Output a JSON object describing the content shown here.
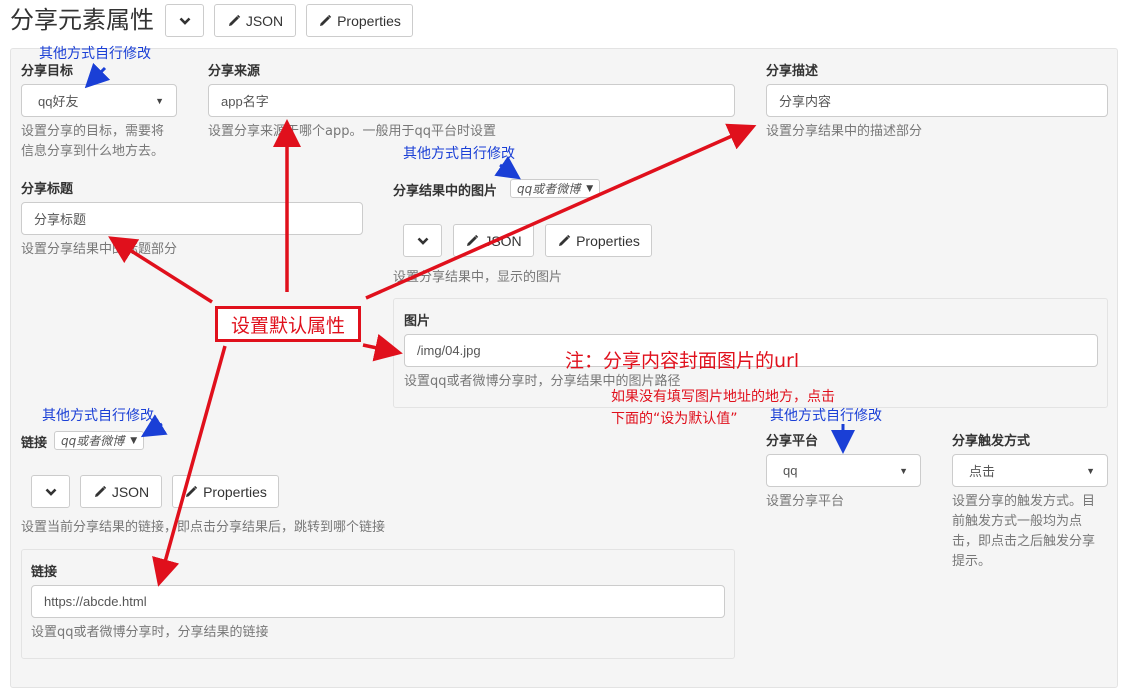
{
  "header": {
    "title": "分享元素属性",
    "json_label": "JSON",
    "properties_label": "Properties"
  },
  "target": {
    "label": "分享目标",
    "selected": "qq好友",
    "help": [
      "设置分享的目标，需要将",
      "信息分享到什么地方去。"
    ]
  },
  "source": {
    "label": "分享来源",
    "value": "app名字",
    "help": "设置分享来源于哪个app。一般用于qq平台时设置"
  },
  "description": {
    "label": "分享描述",
    "value": "分享内容",
    "help": "设置分享结果中的描述部分"
  },
  "title_field": {
    "label": "分享标题",
    "value": "分享标题",
    "help": "设置分享结果中的标题部分"
  },
  "image": {
    "label": "分享结果中的图片",
    "mode": "qq或者微博",
    "json_label": "JSON",
    "properties_label": "Properties",
    "help": "设置分享结果中，显示的图片",
    "inner_label": "图片",
    "value": "/img/04.jpg",
    "inner_help": "设置qq或者微博分享时，分享结果中的图片路径"
  },
  "link": {
    "label": "链接",
    "mode": "qq或者微博",
    "json_label": "JSON",
    "properties_label": "Properties",
    "help": "设置当前分享结果的链接，即点击分享结果后，跳转到哪个链接",
    "inner_label": "链接",
    "value": "https://abcde.html",
    "inner_help": "设置qq或者微博分享时，分享结果的链接"
  },
  "platform": {
    "label": "分享平台",
    "selected": "qq",
    "help": "设置分享平台"
  },
  "trigger": {
    "label": "分享触发方式",
    "selected": "点击",
    "help": [
      "设置分享的触发方式。目",
      "前触发方式一般均为点",
      "击，即点击之后触发分享",
      "提示。"
    ]
  },
  "annotations": {
    "other_ways": "其他方式自行修改",
    "set_default": "设置默认属性",
    "note_url": "注：分享内容封面图片的url",
    "note_fill_1": "如果没有填写图片地址的地方，点击",
    "note_fill_2": "下面的“设为默认值”"
  },
  "colors": {
    "annotation_red": "#e0101c",
    "annotation_blue": "#1a3fd6",
    "panel_bg": "#f5f5f5"
  }
}
